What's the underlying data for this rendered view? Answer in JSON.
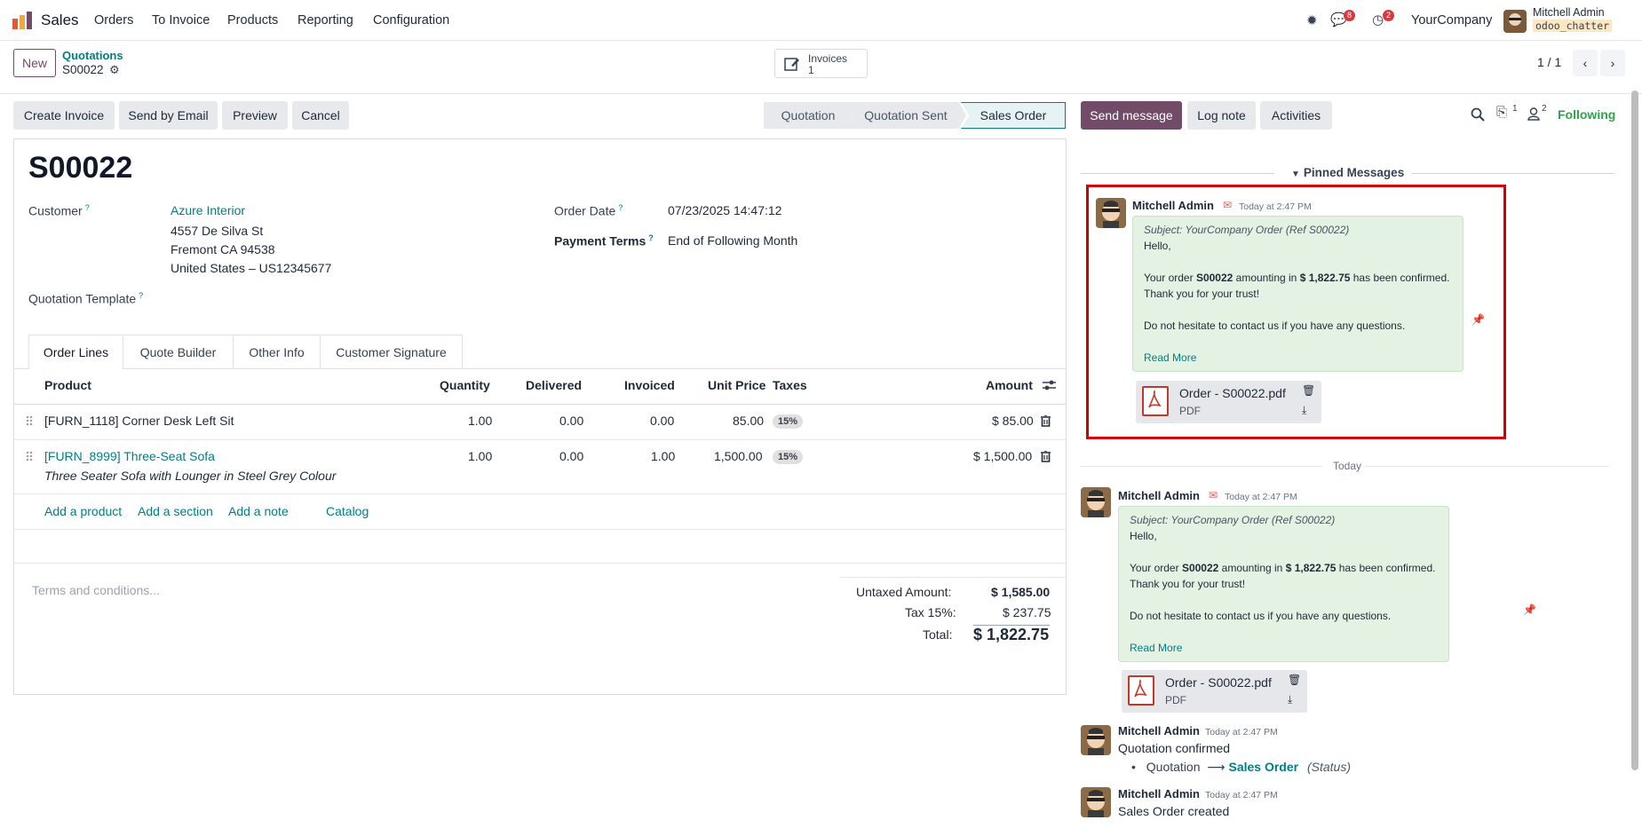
{
  "navbar": {
    "app_name": "Sales",
    "menus": [
      "Orders",
      "To Invoice",
      "Products",
      "Reporting",
      "Configuration"
    ],
    "messages_count": "8",
    "activities_count": "2",
    "company": "YourCompany",
    "user_name": "Mitchell Admin",
    "db_name": "odoo_chatter"
  },
  "control": {
    "new_label": "New",
    "breadcrumb_parent": "Quotations",
    "record_name": "S00022",
    "smart_button_label": "Invoices",
    "smart_button_count": "1",
    "pager": "1 / 1"
  },
  "actions": {
    "create_invoice": "Create Invoice",
    "send_email": "Send by Email",
    "preview": "Preview",
    "cancel": "Cancel"
  },
  "statusbar": [
    "Quotation",
    "Quotation Sent",
    "Sales Order"
  ],
  "form": {
    "title": "S00022",
    "customer_label": "Customer",
    "customer_name": "Azure Interior",
    "address_line1": "4557 De Silva St",
    "address_line2": "Fremont CA 94538",
    "address_line3": "United States – US12345677",
    "template_label": "Quotation Template",
    "order_date_label": "Order Date",
    "order_date": "07/23/2025 14:47:12",
    "payment_terms_label": "Payment Terms",
    "payment_terms": "End of Following Month"
  },
  "tabs": [
    "Order Lines",
    "Quote Builder",
    "Other Info",
    "Customer Signature"
  ],
  "table": {
    "headers": [
      "Product",
      "Quantity",
      "Delivered",
      "Invoiced",
      "Unit Price",
      "Taxes",
      "Amount"
    ],
    "rows": [
      {
        "product": "[FURN_1118] Corner Desk Left Sit",
        "qty": "1.00",
        "delivered": "0.00",
        "invoiced": "0.00",
        "price": "85.00",
        "tax": "15%",
        "amount": "$ 85.00"
      },
      {
        "product": "[FURN_8999] Three-Seat Sofa",
        "description": "Three Seater Sofa with Lounger in Steel Grey Colour",
        "qty": "1.00",
        "delivered": "0.00",
        "invoiced": "1.00",
        "price": "1,500.00",
        "tax": "15%",
        "amount": "$ 1,500.00"
      }
    ],
    "add_product": "Add a product",
    "add_section": "Add a section",
    "add_note": "Add a note",
    "catalog": "Catalog"
  },
  "totals": {
    "terms_placeholder": "Terms and conditions...",
    "untaxed_label": "Untaxed Amount:",
    "untaxed_value": "$ 1,585.00",
    "tax_label": "Tax 15%:",
    "tax_value": "$ 237.75",
    "total_label": "Total:",
    "total_value": "$ 1,822.75"
  },
  "chatter": {
    "send_message": "Send message",
    "log_note": "Log note",
    "activities": "Activities",
    "attachments_count": "1",
    "followers_count": "2",
    "following": "Following",
    "pinned_title": "Pinned Messages",
    "today_label": "Today",
    "author": "Mitchell Admin",
    "time": "Today at 2:47 PM",
    "subject": "Subject: YourCompany Order (Ref S00022)",
    "hello": "Hello,",
    "body_prefix": "Your order ",
    "body_ref": "S00022",
    "body_mid": " amounting in ",
    "body_amount": "$ 1,822.75",
    "body_suffix": " has been confirmed.",
    "thanks": "Thank you for your trust!",
    "questions": "Do not hesitate to contact us if you have any questions.",
    "read_more": "Read More",
    "attachment_name": "Order - S00022.pdf",
    "attachment_type": "PDF",
    "confirmed_text": "Quotation confirmed",
    "status_from": "Quotation",
    "status_to": "Sales Order",
    "status_field": "(Status)",
    "created_text": "Sales Order created"
  }
}
